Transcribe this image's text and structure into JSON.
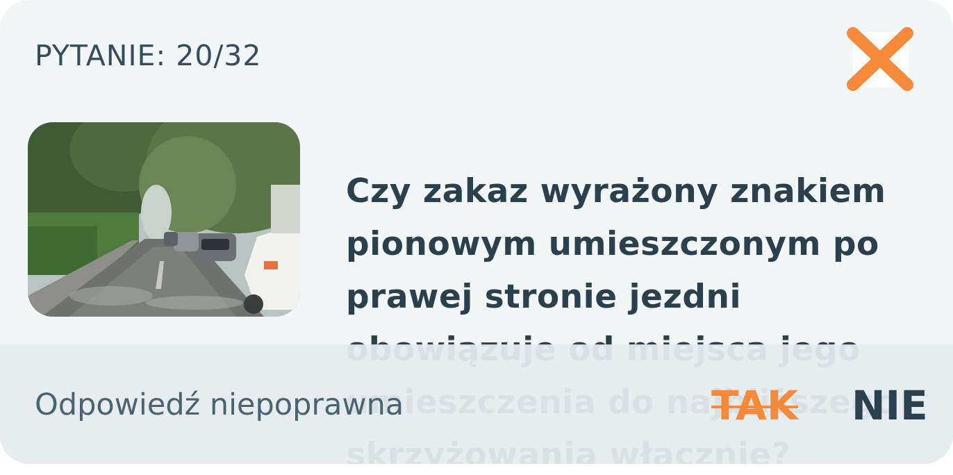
{
  "header": {
    "counter": "PYTANIE: 20/32",
    "close_icon": "close-x-icon"
  },
  "media": {
    "description_icon": "road-scene-photo"
  },
  "question": {
    "text": "Czy zakaz wyrażony znakiem pionowym umieszczonym po prawej stronie jezdni obowiązuje od miejsca jego umieszczenia do najbliższego skrzyżowania włącznie?"
  },
  "answer_bar": {
    "status": "Odpowiedź niepoprawna",
    "yes_label": "TAK",
    "no_label": "NIE"
  },
  "colors": {
    "accent": "#f58a3a",
    "text_dark": "#2a414d",
    "card_bg": "#f3f6f7",
    "bar_bg": "#e5ebee"
  }
}
